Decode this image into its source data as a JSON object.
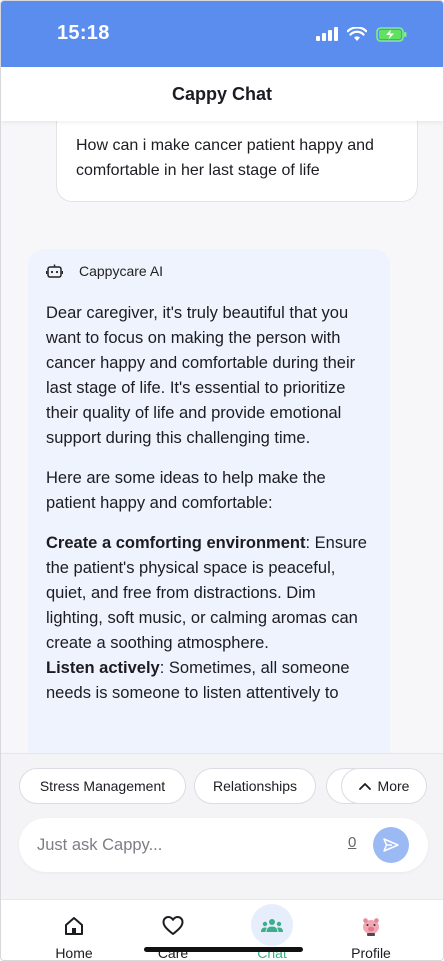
{
  "status_bar": {
    "time": "15:18",
    "accent": "#5b8def"
  },
  "header": {
    "title": "Cappy Chat"
  },
  "messages": {
    "user": "How can i make cancer patient happy and comfortable in her last stage of life",
    "ai_name": "Cappycare AI",
    "ai_p1": "Dear caregiver, it's truly beautiful that you want to focus on making the person with cancer happy and comfortable during their last stage of life. It's essential to prioritize their quality of life and provide emotional support during this challenging time.",
    "ai_p2": "Here are some ideas to help make the patient happy and comfortable:",
    "ai_h1": "Create a comforting environment",
    "ai_t1": ": Ensure the patient's physical space is peaceful, quiet, and free from distractions. Dim lighting, soft music, or calming aromas can create a soothing atmosphere.",
    "ai_h2": "Listen actively",
    "ai_t2": ": Sometimes, all someone needs is someone to listen attentively to"
  },
  "suggestions": {
    "chips": [
      "Stress Management",
      "Relationships"
    ],
    "more_label": "More"
  },
  "input": {
    "placeholder": "Just ask Cappy...",
    "char_count": "0"
  },
  "nav": {
    "items": [
      {
        "label": "Home",
        "icon": "home-icon"
      },
      {
        "label": "Care",
        "icon": "heart-icon"
      },
      {
        "label": "Chat",
        "icon": "group-icon"
      },
      {
        "label": "Profile",
        "icon": "piggy-avatar-icon"
      }
    ],
    "active": "Chat",
    "active_color": "#3cae8b"
  }
}
